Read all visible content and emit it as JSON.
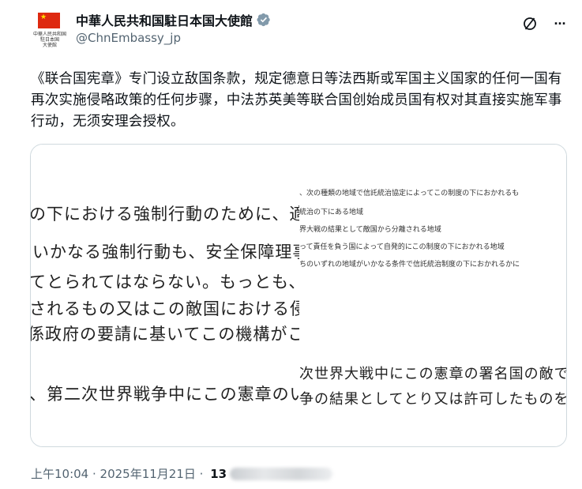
{
  "account": {
    "display_name": "中華人民共和国駐日本国大使館",
    "handle": "@ChnEmbassy_jp",
    "avatar_text": "中華人民共和国\n駐日本国\n大使館",
    "verified_color": "#829aab"
  },
  "top_actions": {
    "grok_icon": "slashed-circle-icon",
    "more_icon": "more-dots-icon",
    "more_label": "···"
  },
  "tweet": {
    "text": "《联合国宪章》专门设立敌国条款，规定德意日等法西斯或军国主义国家的任何一国有再次实施侵略政策的任何步骤，中法苏英美等联合国创始成员国有权对其直接实施军事行动，无须安理会授权。"
  },
  "media": {
    "left_lines": [
      "の下における強制行動のために、適当な",
      "いかなる強制行動も、安全保障理事会",
      "てとられてはならない。もっとも、本条",
      "されるもの又はこの敵国における侵略",
      "係政府の要請に基いてこの機構がこの敵",
      "、第二次世界戦争中にこの憲章のいず"
    ],
    "right_small_lines": [
      "、次の種類の地域で信託統治協定によってこの制度の下におかれるも",
      "統治の下にある地域",
      "界大戦の結果として敵国から分離される地域",
      "って責任を負う国によって自発的にこの制度の下におかれる地域",
      "ちのいずれの地域がいかなる条件で信託統治制度の下におかれるかに"
    ],
    "right_big_lines": [
      "次世界大戦中にこの憲章の署名国の敵であ",
      "争の結果としてとり又は許可したものを無"
    ]
  },
  "meta": {
    "time": "上午10:04",
    "separator": " · ",
    "date": "2025年11月21日",
    "separator2": " · ",
    "views_prefix": "13"
  }
}
